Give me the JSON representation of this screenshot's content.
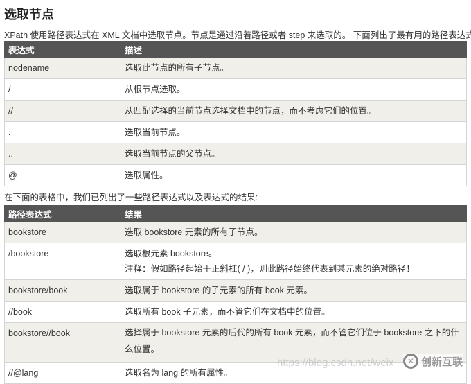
{
  "title": "选取节点",
  "intro": "XPath 使用路径表达式在 XML 文档中选取节点。节点是通过沿着路径或者 step 来选取的。 下面列出了最有用的路径表达式:",
  "table1": {
    "headers": [
      "表达式",
      "描述"
    ],
    "rows": [
      [
        "nodename",
        "选取此节点的所有子节点。"
      ],
      [
        "/",
        "从根节点选取。"
      ],
      [
        "//",
        "从匹配选择的当前节点选择文档中的节点，而不考虑它们的位置。"
      ],
      [
        ".",
        "选取当前节点。"
      ],
      [
        "..",
        "选取当前节点的父节点。"
      ],
      [
        "@",
        "选取属性。"
      ]
    ]
  },
  "between": "在下面的表格中，我们已列出了一些路径表达式以及表达式的结果:",
  "table2": {
    "headers": [
      "路径表达式",
      "结果"
    ],
    "rows": [
      [
        "bookstore",
        "选取 bookstore 元素的所有子节点。"
      ],
      [
        "/bookstore",
        "选取根元素 bookstore。",
        "注释：假如路径起始于正斜杠( / )，则此路径始终代表到某元素的绝对路径！"
      ],
      [
        "bookstore/book",
        "选取属于 bookstore 的子元素的所有 book 元素。"
      ],
      [
        "//book",
        "选取所有 book 子元素，而不管它们在文档中的位置。"
      ],
      [
        "bookstore//book",
        "选择属于 bookstore 元素的后代的所有 book 元素，而不管它们位于 bookstore 之下的什么位置。"
      ],
      [
        "//@lang",
        "选取名为 lang 的所有属性。"
      ]
    ]
  },
  "watermark": "https://blog.csdn.net/weix",
  "logo": "创新互联"
}
